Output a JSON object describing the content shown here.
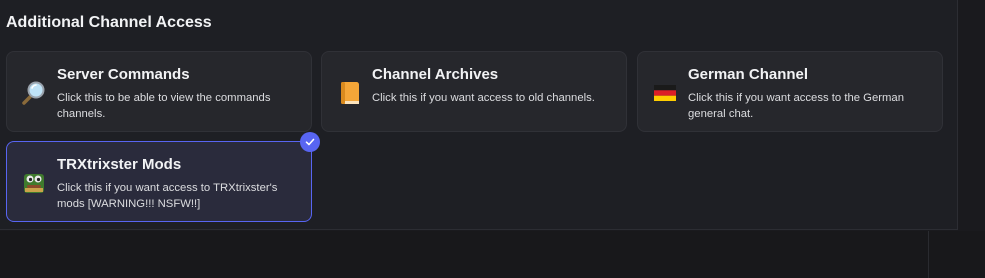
{
  "section": {
    "title": "Additional Channel Access"
  },
  "options": [
    {
      "name": "Server Commands",
      "description": "Click this to be able to view the commands channels.",
      "icon": "magnifying-glass-icon"
    },
    {
      "name": "Channel Archives",
      "description": "Click this if you want access to old channels.",
      "icon": "orange-book-icon"
    },
    {
      "name": "German Channel",
      "description": "Click this if you want access to the German general chat.",
      "icon": "germany-flag-icon"
    },
    {
      "name": "TRXtrixster Mods",
      "description": "Click this if you want access to TRXtrixster's mods [WARNING!!! NSFW!!]",
      "icon": "frog-emoji-icon",
      "selected": true
    }
  ],
  "colors": {
    "accent": "#5865f2",
    "card_bg": "#26272c",
    "panel_bg": "#1e1f24"
  }
}
